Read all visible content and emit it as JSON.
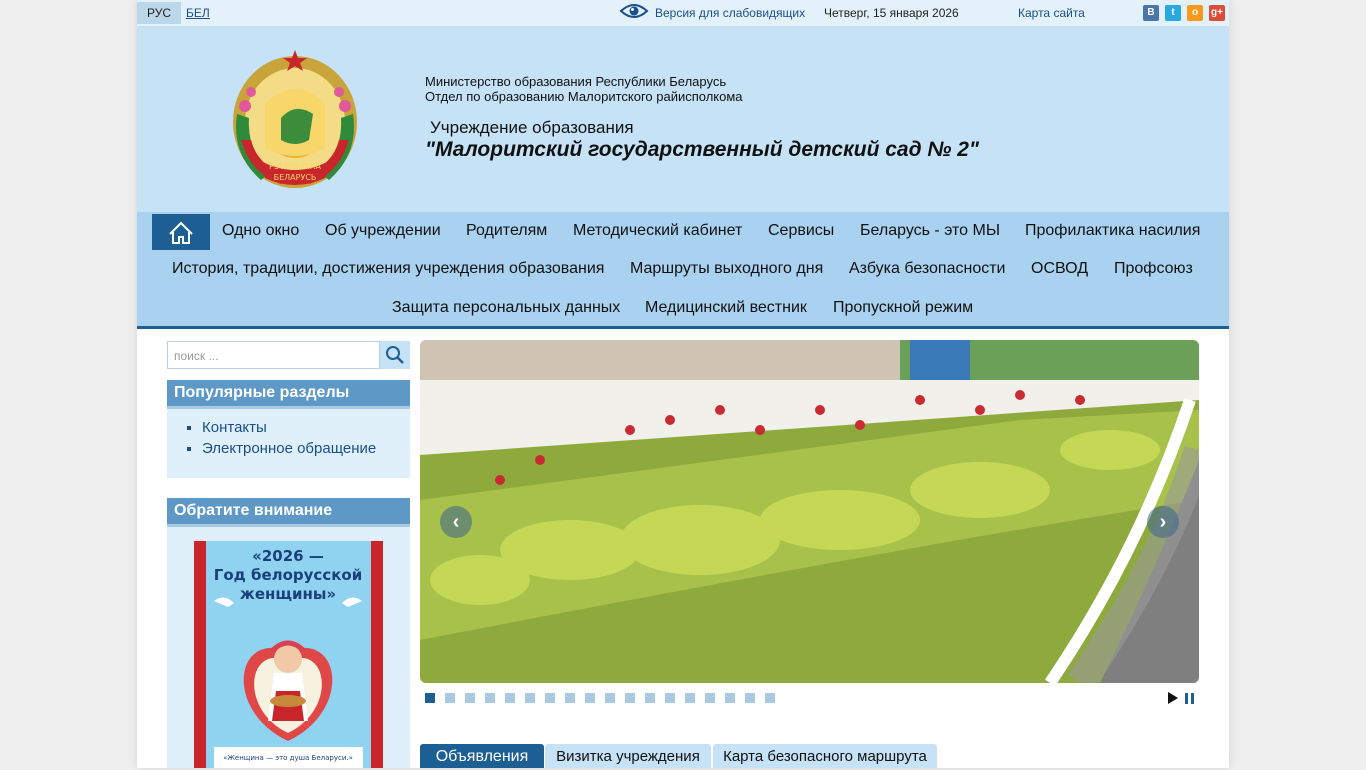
{
  "topbar": {
    "lang_ru": "РУС",
    "lang_be": "БЕЛ",
    "vision_link": "Версия для слабовидящих",
    "date": "Четверг, 15 января 2026",
    "sitemap_link": "Карта сайта",
    "socials": [
      {
        "icon": "vkontakte-icon",
        "letter": "B",
        "color": "#4a76a8"
      },
      {
        "icon": "twitter-icon",
        "letter": "t",
        "color": "#2aa9e0"
      },
      {
        "icon": "odnoklassniki-icon",
        "letter": "o",
        "color": "#f59a1b"
      },
      {
        "icon": "google-plus-icon",
        "letter": "g+",
        "color": "#dd4b39"
      }
    ]
  },
  "header": {
    "ministry": "Министерство образования Республики Беларусь",
    "department": "Отдел по образованию Малоритского райисполкома",
    "institution_label": "Учреждение образования",
    "institution_name": "\"Малоритский государственный детский сад № 2\"",
    "emblem_text_1": "РЭСПУБЛІКА",
    "emblem_text_2": "БЕЛАРУСЬ"
  },
  "nav": {
    "home_icon": "home-icon",
    "row1": [
      "Одно окно",
      "Об учреждении",
      "Родителям",
      "Методический кабинет",
      "Сервисы",
      "Беларусь - это МЫ",
      "Профилактика насилия"
    ],
    "row2": [
      "История, традиции, достижения учреждения образования",
      "Маршруты выходного дня",
      "Азбука безопасности",
      "ОСВОД",
      "Профсоюз"
    ],
    "row3": [
      "Защита персональных данных",
      "Медицинский вестник",
      "Пропускной режим"
    ]
  },
  "search": {
    "placeholder": "поиск ..."
  },
  "popular": {
    "title": "Популярные разделы",
    "items": [
      "Контакты",
      "Электронное обращение"
    ]
  },
  "attention": {
    "title": "Обратите внимание",
    "banner_line1": "«2026 —",
    "banner_line2": "Год белорусской",
    "banner_line3": "женщины»",
    "banner_caption": "«Женщина — это душа Беларуси.»"
  },
  "slider": {
    "prev_label": "‹",
    "next_label": "›",
    "slide_count": 18,
    "active_slide": 1
  },
  "tabs": [
    "Объявления",
    "Визитка учреждения",
    "Карта безопасного маршрута"
  ],
  "colors": {
    "nav_bg": "#a9d2f0",
    "header_bg": "#c5e2f7",
    "accent": "#1d5e93"
  }
}
